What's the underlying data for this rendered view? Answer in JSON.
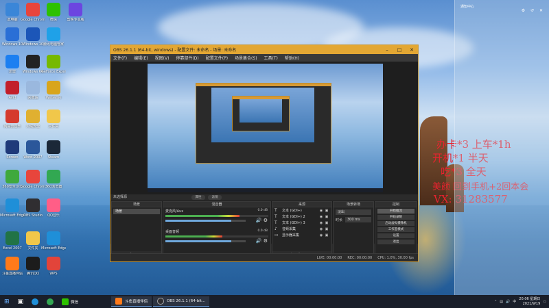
{
  "desktop": {
    "icons": [
      {
        "label": "此电脑",
        "color": "#3a86d8"
      },
      {
        "label": "Google Chrome",
        "color": "#e8453c"
      },
      {
        "label": "微信",
        "color": "#2dc100"
      },
      {
        "label": "剪映专业版",
        "color": "#6c45e0"
      },
      {
        "label": "Windows 10",
        "color": "#2a6fd6"
      },
      {
        "label": "Windows 10",
        "color": "#1c56b8"
      },
      {
        "label": "腾讯电脑管家",
        "color": "#1fa1e8"
      },
      {
        "label": "迅雷",
        "color": "#1b7ff1"
      },
      {
        "label": "Windows 64",
        "color": "#222222"
      },
      {
        "label": "GeForce Experience",
        "color": "#76b900"
      },
      {
        "label": "Avid",
        "color": "#c21e2a"
      },
      {
        "label": "回收站",
        "color": "#9ab8de"
      },
      {
        "label": "WeGame",
        "color": "#d8a51c"
      },
      {
        "label": "网易云音乐",
        "color": "#d53a2d"
      },
      {
        "label": "火绒安全",
        "color": "#e0b030"
      },
      {
        "label": "文件夹",
        "color": "#f1c74a"
      },
      {
        "label": "Screen",
        "color": "#1f3a7a"
      },
      {
        "label": "Word 2007",
        "color": "#2b579a"
      },
      {
        "label": "Steam",
        "color": "#1b2838"
      },
      {
        "label": "360安全卫士",
        "color": "#3fa93d"
      },
      {
        "label": "Google Chrome",
        "color": "#e8453c"
      },
      {
        "label": "360浏览器",
        "color": "#32a852"
      },
      {
        "label": "Microsoft Edge",
        "color": "#1f8fd8"
      },
      {
        "label": "OBS Studio",
        "color": "#302e31"
      },
      {
        "label": "QQ音乐",
        "color": "#ff5e87"
      },
      {
        "label": "Excel 2007",
        "color": "#217346"
      },
      {
        "label": "文件夹",
        "color": "#f1c74a"
      },
      {
        "label": "Microsoft Edge",
        "color": "#1f8fd8"
      },
      {
        "label": "斗鱼直播伴侣",
        "color": "#ff7a1a"
      },
      {
        "label": "腾讯QQ",
        "color": "#1c1c1c"
      },
      {
        "label": "WPS",
        "color": "#e2443a"
      }
    ]
  },
  "obs": {
    "title": "OBS 26.1.1 (64-bit, windows) - 配置文件: 未命名 - 场景: 未命名",
    "menu": [
      "文件(F)",
      "编辑(E)",
      "视图(V)",
      "停靠部件(D)",
      "配置文件(P)",
      "场景集合(S)",
      "工具(T)",
      "帮助(H)"
    ],
    "scene_line": "未选择源",
    "mode_buttons": [
      "属性",
      "滤镜"
    ],
    "docks": {
      "scenes": {
        "header": "场景",
        "items": [
          "场景"
        ]
      },
      "mixer": {
        "header": "混音器",
        "channels": [
          {
            "name": "麦克风/Aux",
            "db": "0.0 dB",
            "level": 0.72,
            "volume": 0.82
          },
          {
            "name": "桌面音频",
            "db": "0.0 dB",
            "level": 0.55,
            "volume": 0.82
          }
        ]
      },
      "sources": {
        "header": "来源",
        "items": [
          "文本 (GDI+)",
          "文本 (GDI+) 2",
          "文本 (GDI+) 3",
          "音频采集",
          "显示器采集"
        ]
      },
      "transitions": {
        "header": "场景转场",
        "type": "淡出",
        "duration_label": "时长",
        "duration_value": "300 ms"
      },
      "controls": {
        "header": "控制",
        "buttons": [
          "开始推流",
          "开始录制",
          "启动虚拟摄像机",
          "工作室模式",
          "设置",
          "退出"
        ]
      }
    },
    "status": {
      "live": "LIVE: 00:00:00",
      "rec": "REC: 00:00:00",
      "cpu": "CPU: 1.0%, 30.00 fps"
    }
  },
  "overlay": {
    "lines": [
      "办卡*3 上车*1h",
      "开机*1 半天",
      "吃*3 全天",
      "美颜 回到手机+2回本会",
      "VX: 31283577"
    ]
  },
  "notify_panel": {
    "title": "通知中心",
    "icons": "⚙ ↺ ✕"
  },
  "taskbar": {
    "apps": [
      "斗鱼直播伴侣",
      "OBS 26.1.1 (64-bit..."
    ],
    "search_app": "微信",
    "clock_time": "20:06 星期日",
    "clock_date": "2021/9/19"
  }
}
